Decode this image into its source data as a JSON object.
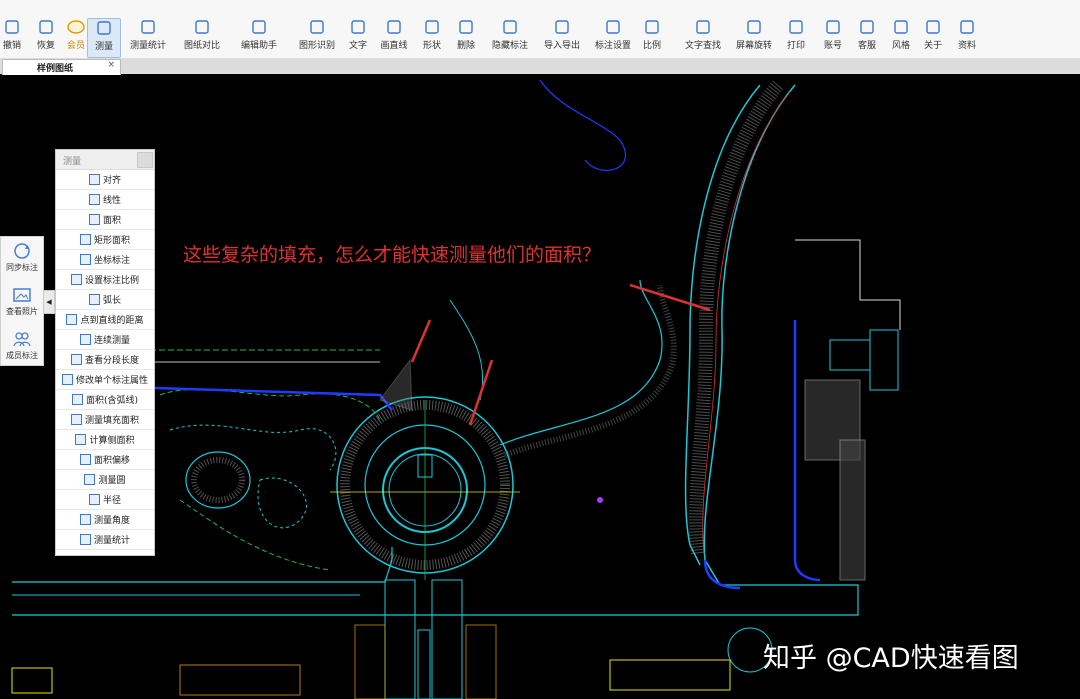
{
  "toolbar": {
    "items": [
      {
        "label": "撤销",
        "icon": "undo-icon"
      },
      {
        "label": "恢复",
        "icon": "redo-icon"
      },
      {
        "label": "会员",
        "icon": "vip-icon"
      },
      {
        "label": "测量",
        "icon": "measure-icon",
        "active": true
      },
      {
        "label": "测量统计",
        "icon": "measure-stats-icon"
      },
      {
        "label": "图纸对比",
        "icon": "compare-icon"
      },
      {
        "label": "编辑助手",
        "icon": "edit-assistant-icon"
      },
      {
        "label": "图形识别",
        "icon": "shape-recognition-icon"
      },
      {
        "label": "文字",
        "icon": "text-icon"
      },
      {
        "label": "画直线",
        "icon": "line-icon"
      },
      {
        "label": "形状",
        "icon": "shape-icon"
      },
      {
        "label": "删除",
        "icon": "eraser-icon"
      },
      {
        "label": "隐藏标注",
        "icon": "hide-annotation-icon"
      },
      {
        "label": "导入导出",
        "icon": "import-export-icon"
      },
      {
        "label": "标注设置",
        "icon": "annotation-settings-icon"
      },
      {
        "label": "比例",
        "icon": "scale-icon"
      },
      {
        "label": "文字查找",
        "icon": "text-search-icon"
      },
      {
        "label": "屏幕旋转",
        "icon": "rotate-screen-icon"
      },
      {
        "label": "打印",
        "icon": "print-icon"
      },
      {
        "label": "账号",
        "icon": "account-icon"
      },
      {
        "label": "客服",
        "icon": "customer-service-icon"
      },
      {
        "label": "风格",
        "icon": "style-icon"
      },
      {
        "label": "关于",
        "icon": "about-icon"
      },
      {
        "label": "资料",
        "icon": "resources-icon"
      }
    ]
  },
  "tab": {
    "title": "样例图纸",
    "close": "×"
  },
  "panel": {
    "title": "测量",
    "items": [
      "对齐",
      "线性",
      "面积",
      "矩形面积",
      "坐标标注",
      "设置标注比例",
      "弧长",
      "点到直线的距离",
      "连续测量",
      "查看分段长度",
      "修改单个标注属性",
      "面积(含弧线)",
      "测量填充面积",
      "计算侧面积",
      "面积偏移",
      "测量圆",
      "半径",
      "测量角度",
      "测量统计"
    ]
  },
  "sidebar": {
    "items": [
      {
        "label": "同步标注",
        "icon": "sync-icon"
      },
      {
        "label": "查看照片",
        "icon": "photo-icon"
      },
      {
        "label": "成员标注",
        "icon": "members-icon"
      }
    ],
    "toggle": "◀"
  },
  "annotation": {
    "text": "这些复杂的填充，怎么才能快速测量他们的面积？",
    "color": "#e03131"
  },
  "watermark": {
    "text": "知乎 @CAD快速看图"
  },
  "colors": {
    "canvas_bg": "#000000",
    "cad_cyan": "#19c9d8",
    "cad_green": "#1fb84a",
    "cad_blue": "#1e3cff",
    "cad_yellow": "#e8e300",
    "cad_red": "#e03131"
  }
}
